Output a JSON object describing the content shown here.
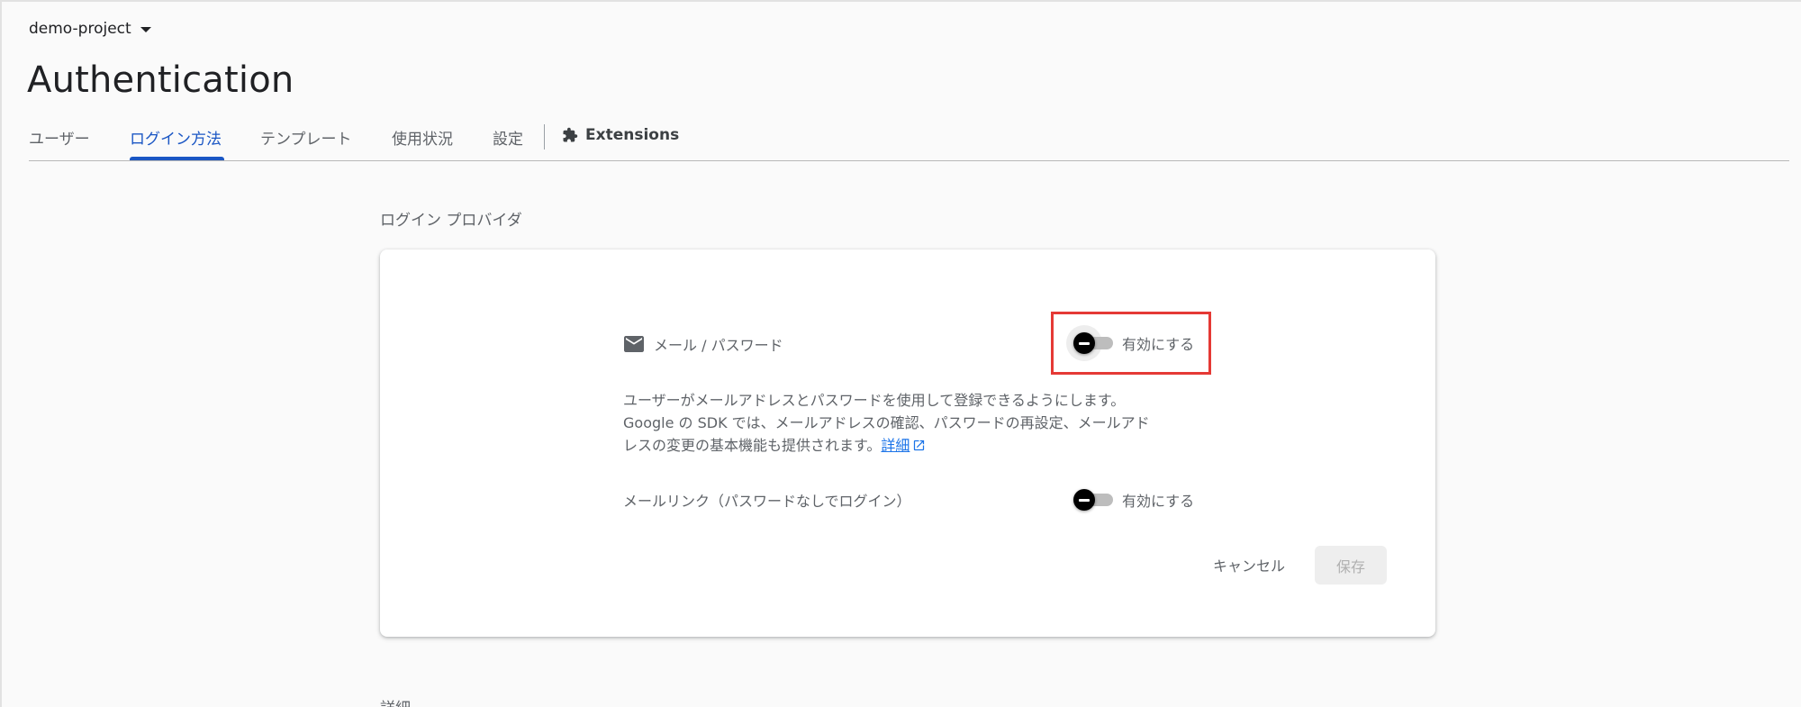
{
  "header": {
    "project_name": "demo-project",
    "page_title": "Authentication"
  },
  "tabs": [
    {
      "label": "ユーザー"
    },
    {
      "label": "ログイン方法",
      "active": true
    },
    {
      "label": "テンプレート"
    },
    {
      "label": "使用状況"
    },
    {
      "label": "設定"
    }
  ],
  "extensions_tab": {
    "label": "Extensions",
    "icon": "puzzle-piece-icon"
  },
  "main": {
    "section_label": "ログイン プロバイダ",
    "details_label": "詳細"
  },
  "provider": {
    "icon": "mail-icon",
    "name": "メール / パスワード",
    "enable_toggle": {
      "label": "有効にする",
      "enabled": false
    },
    "description_line1": "ユーザーがメールアドレスとパスワードを使用して登録できるようにします。",
    "description_line2": "Google の SDK では、メールアドレスの確認、パスワードの再設定、メールアド",
    "description_line3": "レスの変更の基本機能も提供されます。",
    "learn_more_link": "詳細",
    "email_link_label": "メールリンク（パスワードなしでログイン）",
    "email_link_toggle": {
      "label": "有効にする",
      "enabled": false
    }
  },
  "actions": {
    "cancel_label": "キャンセル",
    "save_label": "保存"
  },
  "colors": {
    "accent": "#1a56c4",
    "link": "#1a73e8",
    "highlight": "#e53935",
    "toggle_thumb": "#000000",
    "toggle_track": "#bdbdbd"
  }
}
